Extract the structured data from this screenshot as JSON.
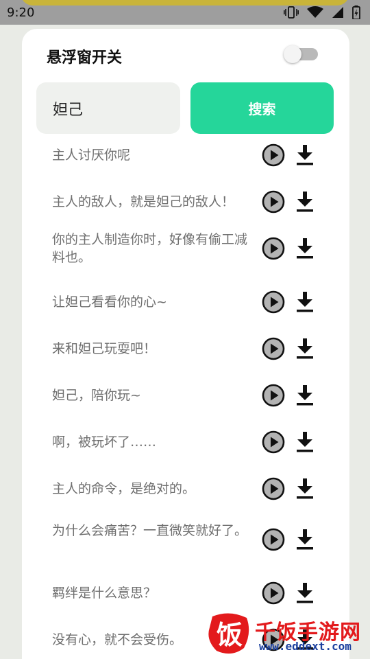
{
  "status_bar": {
    "time": "9:20",
    "icons": [
      "vibrate-icon",
      "wifi-icon",
      "signal-icon",
      "battery-icon"
    ]
  },
  "floating_window": {
    "label": "悬浮窗开关",
    "enabled": false
  },
  "search": {
    "value": "妲己",
    "button_label": "搜索"
  },
  "voice_lines": [
    {
      "text": "主人讨厌你呢"
    },
    {
      "text": "主人的敌人，就是妲己的敌人！"
    },
    {
      "text": "你的主人制造你时，好像有偷工减料也。"
    },
    {
      "text": "让妲己看看你的心~"
    },
    {
      "text": "来和妲己玩耍吧！"
    },
    {
      "text": "妲己，陪你玩~"
    },
    {
      "text": "啊，被玩坏了……"
    },
    {
      "text": "主人的命令，是绝对的。"
    },
    {
      "text": "为什么会痛苦？一直微笑就好了。"
    },
    {
      "text": "羁绊是什么意思？"
    },
    {
      "text": "没有心，就不会受伤。"
    }
  ],
  "watermark": {
    "logo_char": "饭",
    "title": "千饭手游网",
    "url": "www.eddext.com"
  },
  "colors": {
    "accent": "#25d69a",
    "background": "#e9ebe6",
    "card": "#ffffff",
    "search_field": "#eff1ee",
    "watermark_red": "#e31a1c"
  }
}
